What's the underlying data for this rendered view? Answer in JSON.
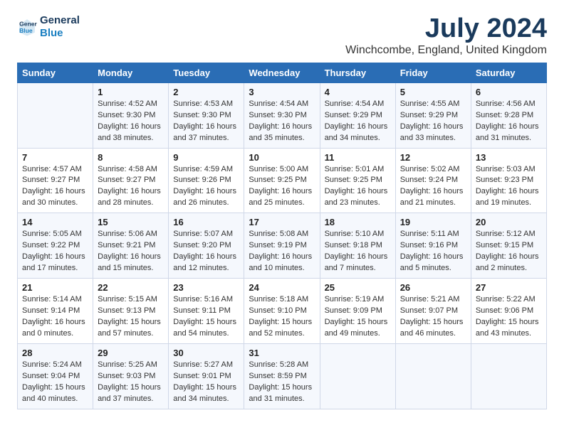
{
  "logo": {
    "line1": "General",
    "line2": "Blue"
  },
  "title": "July 2024",
  "subtitle": "Winchcombe, England, United Kingdom",
  "days_header": [
    "Sunday",
    "Monday",
    "Tuesday",
    "Wednesday",
    "Thursday",
    "Friday",
    "Saturday"
  ],
  "weeks": [
    [
      {
        "day": "",
        "info": ""
      },
      {
        "day": "1",
        "info": "Sunrise: 4:52 AM\nSunset: 9:30 PM\nDaylight: 16 hours\nand 38 minutes."
      },
      {
        "day": "2",
        "info": "Sunrise: 4:53 AM\nSunset: 9:30 PM\nDaylight: 16 hours\nand 37 minutes."
      },
      {
        "day": "3",
        "info": "Sunrise: 4:54 AM\nSunset: 9:30 PM\nDaylight: 16 hours\nand 35 minutes."
      },
      {
        "day": "4",
        "info": "Sunrise: 4:54 AM\nSunset: 9:29 PM\nDaylight: 16 hours\nand 34 minutes."
      },
      {
        "day": "5",
        "info": "Sunrise: 4:55 AM\nSunset: 9:29 PM\nDaylight: 16 hours\nand 33 minutes."
      },
      {
        "day": "6",
        "info": "Sunrise: 4:56 AM\nSunset: 9:28 PM\nDaylight: 16 hours\nand 31 minutes."
      }
    ],
    [
      {
        "day": "7",
        "info": "Sunrise: 4:57 AM\nSunset: 9:27 PM\nDaylight: 16 hours\nand 30 minutes."
      },
      {
        "day": "8",
        "info": "Sunrise: 4:58 AM\nSunset: 9:27 PM\nDaylight: 16 hours\nand 28 minutes."
      },
      {
        "day": "9",
        "info": "Sunrise: 4:59 AM\nSunset: 9:26 PM\nDaylight: 16 hours\nand 26 minutes."
      },
      {
        "day": "10",
        "info": "Sunrise: 5:00 AM\nSunset: 9:25 PM\nDaylight: 16 hours\nand 25 minutes."
      },
      {
        "day": "11",
        "info": "Sunrise: 5:01 AM\nSunset: 9:25 PM\nDaylight: 16 hours\nand 23 minutes."
      },
      {
        "day": "12",
        "info": "Sunrise: 5:02 AM\nSunset: 9:24 PM\nDaylight: 16 hours\nand 21 minutes."
      },
      {
        "day": "13",
        "info": "Sunrise: 5:03 AM\nSunset: 9:23 PM\nDaylight: 16 hours\nand 19 minutes."
      }
    ],
    [
      {
        "day": "14",
        "info": "Sunrise: 5:05 AM\nSunset: 9:22 PM\nDaylight: 16 hours\nand 17 minutes."
      },
      {
        "day": "15",
        "info": "Sunrise: 5:06 AM\nSunset: 9:21 PM\nDaylight: 16 hours\nand 15 minutes."
      },
      {
        "day": "16",
        "info": "Sunrise: 5:07 AM\nSunset: 9:20 PM\nDaylight: 16 hours\nand 12 minutes."
      },
      {
        "day": "17",
        "info": "Sunrise: 5:08 AM\nSunset: 9:19 PM\nDaylight: 16 hours\nand 10 minutes."
      },
      {
        "day": "18",
        "info": "Sunrise: 5:10 AM\nSunset: 9:18 PM\nDaylight: 16 hours\nand 7 minutes."
      },
      {
        "day": "19",
        "info": "Sunrise: 5:11 AM\nSunset: 9:16 PM\nDaylight: 16 hours\nand 5 minutes."
      },
      {
        "day": "20",
        "info": "Sunrise: 5:12 AM\nSunset: 9:15 PM\nDaylight: 16 hours\nand 2 minutes."
      }
    ],
    [
      {
        "day": "21",
        "info": "Sunrise: 5:14 AM\nSunset: 9:14 PM\nDaylight: 16 hours\nand 0 minutes."
      },
      {
        "day": "22",
        "info": "Sunrise: 5:15 AM\nSunset: 9:13 PM\nDaylight: 15 hours\nand 57 minutes."
      },
      {
        "day": "23",
        "info": "Sunrise: 5:16 AM\nSunset: 9:11 PM\nDaylight: 15 hours\nand 54 minutes."
      },
      {
        "day": "24",
        "info": "Sunrise: 5:18 AM\nSunset: 9:10 PM\nDaylight: 15 hours\nand 52 minutes."
      },
      {
        "day": "25",
        "info": "Sunrise: 5:19 AM\nSunset: 9:09 PM\nDaylight: 15 hours\nand 49 minutes."
      },
      {
        "day": "26",
        "info": "Sunrise: 5:21 AM\nSunset: 9:07 PM\nDaylight: 15 hours\nand 46 minutes."
      },
      {
        "day": "27",
        "info": "Sunrise: 5:22 AM\nSunset: 9:06 PM\nDaylight: 15 hours\nand 43 minutes."
      }
    ],
    [
      {
        "day": "28",
        "info": "Sunrise: 5:24 AM\nSunset: 9:04 PM\nDaylight: 15 hours\nand 40 minutes."
      },
      {
        "day": "29",
        "info": "Sunrise: 5:25 AM\nSunset: 9:03 PM\nDaylight: 15 hours\nand 37 minutes."
      },
      {
        "day": "30",
        "info": "Sunrise: 5:27 AM\nSunset: 9:01 PM\nDaylight: 15 hours\nand 34 minutes."
      },
      {
        "day": "31",
        "info": "Sunrise: 5:28 AM\nSunset: 8:59 PM\nDaylight: 15 hours\nand 31 minutes."
      },
      {
        "day": "",
        "info": ""
      },
      {
        "day": "",
        "info": ""
      },
      {
        "day": "",
        "info": ""
      }
    ]
  ]
}
